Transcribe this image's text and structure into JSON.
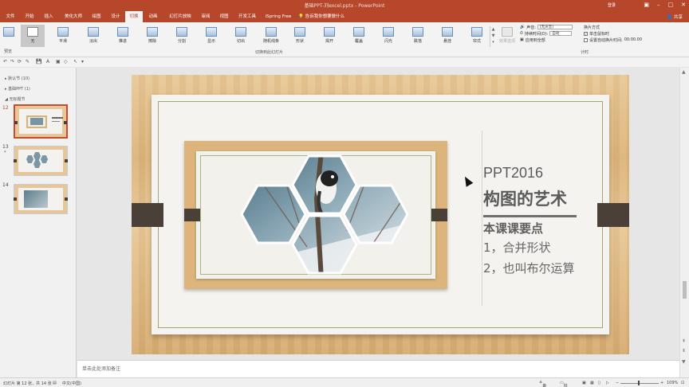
{
  "window": {
    "title": "基础PPT-刘excel.pptx - PowerPoint",
    "login": "登录",
    "share": "共享"
  },
  "menu": {
    "tabs": [
      "文件",
      "开始",
      "插入",
      "美化大师",
      "绘图",
      "设计",
      "切换",
      "动画",
      "幻灯片放映",
      "审阅",
      "视图",
      "开发工具",
      "iSpring Free"
    ],
    "active": "切换",
    "tell_me": "告诉我你想要做什么"
  },
  "ribbon": {
    "preview_label": "预览",
    "group_label": "切换到此幻灯片",
    "timing_label": "计时",
    "transitions": [
      "无",
      "平滑",
      "淡出",
      "推进",
      "擦除",
      "分割",
      "显示",
      "切出",
      "随机线条",
      "形状",
      "揭开",
      "覆盖",
      "闪光",
      "跌落",
      "悬挂",
      "帘式"
    ],
    "effect_options": "效果选项",
    "sound_label": "声音:",
    "sound_value": "[无声音]",
    "duration_label": "持续时间(D):",
    "duration_value": "自动",
    "apply_all": "应用到全部",
    "advance_label": "换片方式",
    "on_click": "单击鼠标时",
    "after_label": "设置自动换片时间:",
    "after_value": "00:00.00"
  },
  "sections": [
    {
      "label": "默认节 (10)"
    },
    {
      "label": "基础PPT (1)"
    },
    {
      "label": "无标题节"
    }
  ],
  "slides": [
    {
      "num": "12"
    },
    {
      "num": "13"
    },
    {
      "num": "14"
    }
  ],
  "slide_content": {
    "en_title": "PPT2016",
    "title": "构图的艺术",
    "subtitle": "本课课要点",
    "point1": "1，合并形状",
    "point2": "2，也叫布尔运算"
  },
  "notes_placeholder": "单击此处添加备注",
  "status": {
    "slide_info": "幻灯片 第 12 张，共 14 张",
    "language": "中文(中国)",
    "notes_btn": "备注",
    "comments_btn": "批注",
    "zoom": "109%"
  },
  "colors": {
    "accent": "#b7472a",
    "wood": "#dcb47c",
    "board": "#f4f3f0",
    "frame_line": "#9caa72",
    "tab_dark": "#4b4038"
  }
}
